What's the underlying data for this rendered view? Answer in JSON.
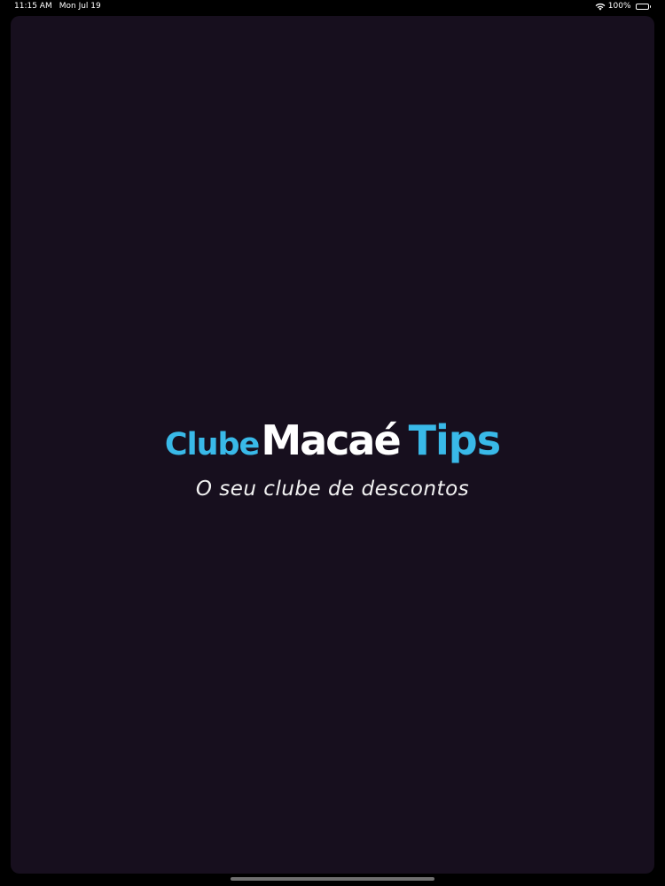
{
  "status_bar": {
    "time": "11:15 AM",
    "date": "Mon Jul 19",
    "battery_percent": "100%",
    "battery_level": 1.0
  },
  "splash": {
    "logo_word_1": "Clube",
    "logo_word_2": "Macaé",
    "logo_word_3": "Tips",
    "tagline": "O seu clube de descontos"
  },
  "colors": {
    "background": "#170f1e",
    "brand_blue": "#39b9e8",
    "brand_white": "#ffffff"
  },
  "icons": {
    "wifi": "wifi-icon",
    "battery": "battery-icon"
  }
}
